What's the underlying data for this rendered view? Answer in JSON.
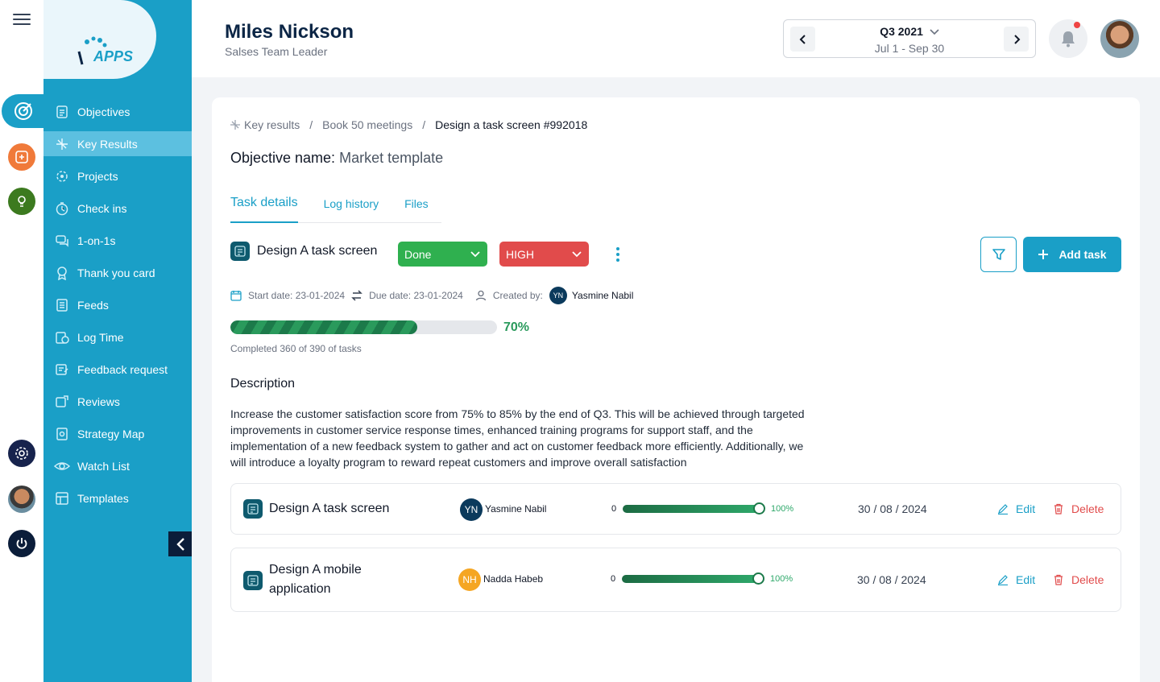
{
  "app": {
    "logo_text": "APPS",
    "logo_prefix": "ID"
  },
  "header": {
    "user_name": "Miles Nickson",
    "user_role": "Salses Team Leader",
    "quarter_title": "Q3 2021",
    "quarter_range": "Jul 1 - Sep 30",
    "notification_dot": true
  },
  "sidebar": {
    "items": [
      {
        "label": "Objectives",
        "icon": "objectives-icon"
      },
      {
        "label": "Key Results",
        "icon": "key-results-icon",
        "active": true
      },
      {
        "label": "Projects",
        "icon": "projects-icon"
      },
      {
        "label": "Check ins",
        "icon": "check-ins-icon"
      },
      {
        "label": "1-on-1s",
        "icon": "chat-icon"
      },
      {
        "label": "Thank you card",
        "icon": "award-icon"
      },
      {
        "label": "Feeds",
        "icon": "feeds-icon"
      },
      {
        "label": "Log Time",
        "icon": "log-time-icon"
      },
      {
        "label": "Feedback request",
        "icon": "feedback-icon"
      },
      {
        "label": "Reviews",
        "icon": "reviews-icon"
      },
      {
        "label": "Strategy Map",
        "icon": "strategy-map-icon"
      },
      {
        "label": "Watch List",
        "icon": "eye-icon"
      },
      {
        "label": "Templates",
        "icon": "templates-icon"
      }
    ]
  },
  "breadcrumb": {
    "items": [
      "Key results",
      "Book 50 meetings",
      "Design a task screen #992018"
    ],
    "separator": "/"
  },
  "objective": {
    "label": "Objective name:",
    "value": "Market template"
  },
  "tabs": [
    {
      "label": "Task details",
      "active": true
    },
    {
      "label": "Log history"
    },
    {
      "label": "Files"
    }
  ],
  "task": {
    "name": "Design A task screen",
    "status": "Done",
    "priority": "HIGH",
    "start_date_label": "Start date: 23-01-2024",
    "due_date_label": "Due date: 23-01-2024",
    "created_by_label": "Created by:",
    "creator_initials": "YN",
    "creator_name": "Yasmine Nabil",
    "progress_percent": 70,
    "progress_text": "70%",
    "completed_text": "Completed 360 of 390 of tasks",
    "add_task_label": "Add task",
    "colors": {
      "done": "#2fb04f",
      "high": "#e14b4b",
      "accent": "#1a9fc7"
    }
  },
  "description": {
    "title": "Description",
    "text": "Increase the customer satisfaction score from 75% to 85% by the end of Q3. This will be achieved through targeted improvements in customer service response times, enhanced training programs for support staff, and the implementation of a new feedback system to gather and act on customer feedback more efficiently. Additionally, we will introduce a loyalty program to reward repeat customers and improve overall satisfaction"
  },
  "subtasks": [
    {
      "name": "Design A task screen",
      "initials": "YN",
      "assignee": "Yasmine Nabil",
      "avatar_color": "#0b3a5c",
      "min": "0",
      "progress_percent": 100,
      "percent_text": "100%",
      "date": "30 / 08 / 2024",
      "edit_label": "Edit",
      "delete_label": "Delete"
    },
    {
      "name": "Design A mobile application",
      "initials": "NH",
      "assignee": "Nadda Habeb",
      "avatar_color": "#f5a623",
      "min": "0",
      "progress_percent": 100,
      "percent_text": "100%",
      "date": "30 / 08 / 2024",
      "edit_label": "Edit",
      "delete_label": "Delete"
    }
  ]
}
